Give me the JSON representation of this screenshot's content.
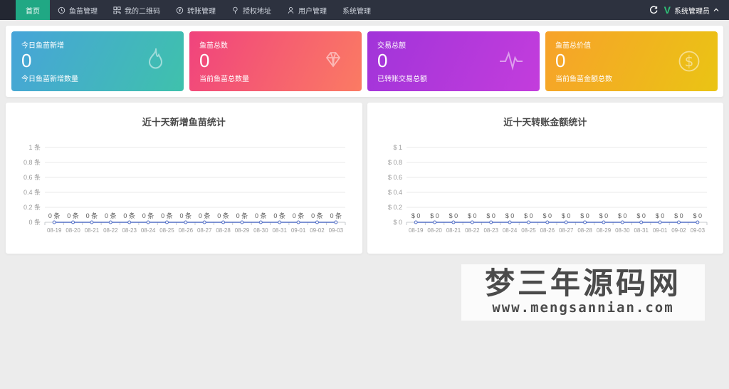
{
  "colors": {
    "nav_bg": "#2d323f",
    "accent_green": "#20a884",
    "chart_line": "#5470c6",
    "page_bg": "#ececec"
  },
  "nav": {
    "items": [
      {
        "label": "首页",
        "icon": null,
        "active": true
      },
      {
        "label": "鱼苗管理",
        "icon": "clock-icon",
        "active": false
      },
      {
        "label": "我的二维码",
        "icon": "qrcode-icon",
        "active": false
      },
      {
        "label": "转账管理",
        "icon": "yuan-circle-icon",
        "active": false
      },
      {
        "label": "授权地址",
        "icon": "location-pin-icon",
        "active": false
      },
      {
        "label": "用户管理",
        "icon": "user-icon",
        "active": false
      },
      {
        "label": "系统管理",
        "icon": null,
        "active": false
      }
    ],
    "user": {
      "name": "系统管理员",
      "avatar_letter": "V"
    }
  },
  "stat_cards": [
    {
      "title": "今日鱼苗新增",
      "value": "0",
      "subtitle": "今日鱼苗新增数量",
      "icon": "flame-icon",
      "gradient": [
        "#47a4d9",
        "#3fc1ac"
      ]
    },
    {
      "title": "鱼苗总数",
      "value": "0",
      "subtitle": "当前鱼苗总数量",
      "icon": "diamond-icon",
      "gradient": [
        "#f0437d",
        "#fb7b63"
      ]
    },
    {
      "title": "交易总额",
      "value": "0",
      "subtitle": "已转账交易总额",
      "icon": "pulse-icon",
      "gradient": [
        "#a134d9",
        "#c33ddc"
      ]
    },
    {
      "title": "鱼苗总价值",
      "value": "0",
      "subtitle": "当前鱼苗金额总数",
      "icon": "dollar-circle-icon",
      "gradient": [
        "#f7a22a",
        "#eac414"
      ]
    }
  ],
  "chart_data": [
    {
      "type": "line",
      "title": "近十天新增鱼苗统计",
      "x": [
        "08-19",
        "08-20",
        "08-21",
        "08-22",
        "08-23",
        "08-24",
        "08-25",
        "08-26",
        "08-27",
        "08-28",
        "08-29",
        "08-30",
        "08-31",
        "09-01",
        "09-02",
        "09-03"
      ],
      "values": [
        0,
        0,
        0,
        0,
        0,
        0,
        0,
        0,
        0,
        0,
        0,
        0,
        0,
        0,
        0,
        0
      ],
      "data_labels": [
        "0 条",
        "0 条",
        "0 条",
        "0 条",
        "0 条",
        "0 条",
        "0 条",
        "0 条",
        "0 条",
        "0 条",
        "0 条",
        "0 条",
        "0 条",
        "0 条",
        "0 条",
        "0 条"
      ],
      "y_tick_labels": [
        "1 条",
        "0.8 条",
        "0.6 条",
        "0.4 条",
        "0.2 条",
        "0 条"
      ],
      "ylim": [
        0,
        1
      ],
      "xlabel": "",
      "ylabel": "",
      "grid": true,
      "legend": null,
      "line_color": "#5470c6"
    },
    {
      "type": "line",
      "title": "近十天转账金额统计",
      "x": [
        "08-19",
        "08-20",
        "08-21",
        "08-22",
        "08-23",
        "08-24",
        "08-25",
        "08-26",
        "08-27",
        "08-28",
        "08-29",
        "08-30",
        "08-31",
        "09-01",
        "09-02",
        "09-03"
      ],
      "values": [
        0,
        0,
        0,
        0,
        0,
        0,
        0,
        0,
        0,
        0,
        0,
        0,
        0,
        0,
        0,
        0
      ],
      "data_labels": [
        "$ 0",
        "$ 0",
        "$ 0",
        "$ 0",
        "$ 0",
        "$ 0",
        "$ 0",
        "$ 0",
        "$ 0",
        "$ 0",
        "$ 0",
        "$ 0",
        "$ 0",
        "$ 0",
        "$ 0",
        "$ 0"
      ],
      "y_tick_labels": [
        "$ 1",
        "$ 0.8",
        "$ 0.6",
        "$ 0.4",
        "$ 0.2",
        "$ 0"
      ],
      "ylim": [
        0,
        1
      ],
      "xlabel": "",
      "ylabel": "",
      "grid": true,
      "legend": null,
      "line_color": "#5470c6"
    }
  ],
  "watermark": {
    "title": "梦三年源码网",
    "url": "www.mengsannian.com"
  }
}
